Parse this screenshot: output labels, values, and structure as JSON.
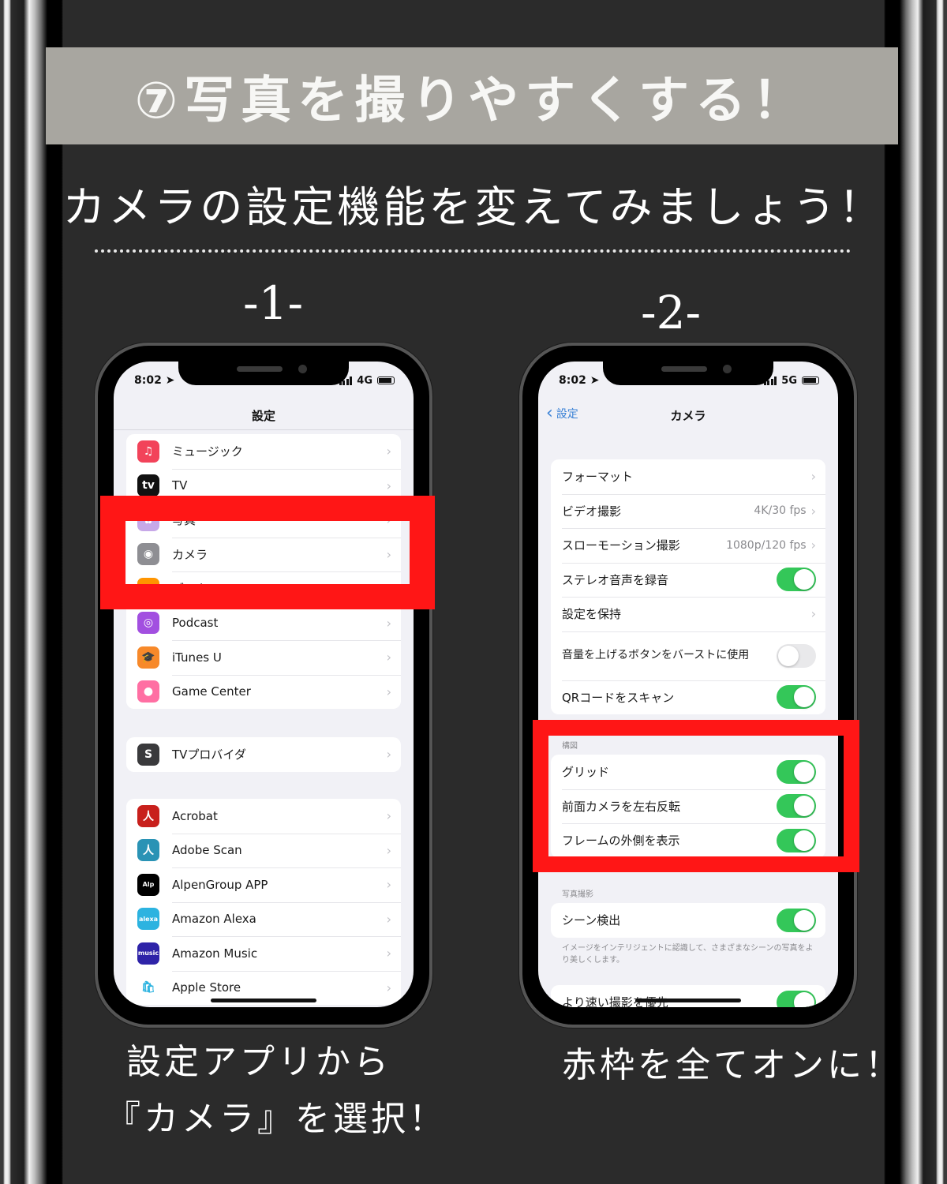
{
  "title": "⑦写真を撮りやすくする！",
  "subtitle": "カメラの設定機能を変えてみましょう！",
  "steps": [
    {
      "number": "-1-",
      "caption_line1": "設定アプリから",
      "caption_line2": "『カメラ』を選択！"
    },
    {
      "number": "-2-",
      "caption_line1": "赤枠を全てオンに！"
    }
  ],
  "phone1": {
    "status": {
      "time": "8:02",
      "network": "4G"
    },
    "nav_title": "設定",
    "group1": [
      {
        "label": "ミュージック",
        "icon": "music-icon",
        "color": "#f2435a",
        "glyph": "♫"
      },
      {
        "label": "TV",
        "icon": "apple-tv-icon",
        "color": "#111111",
        "glyph": "tv"
      },
      {
        "label": "写真",
        "icon": "photos-icon",
        "color": "#c7a8e8",
        "glyph": "✿"
      },
      {
        "label": "カメラ",
        "icon": "camera-icon",
        "color": "#8e8e93",
        "glyph": "◉"
      },
      {
        "label": "ブック",
        "icon": "books-icon",
        "color": "#ff9500",
        "glyph": "▤"
      },
      {
        "label": "Podcast",
        "icon": "podcast-icon",
        "color": "#a24fe0",
        "glyph": "◎"
      },
      {
        "label": "iTunes U",
        "icon": "itunes-u-icon",
        "color": "#f7892a",
        "glyph": "🎓"
      },
      {
        "label": "Game Center",
        "icon": "game-center-icon",
        "color": "#ff6fa3",
        "glyph": "●"
      }
    ],
    "group2": [
      {
        "label": "TVプロバイダ",
        "icon": "tv-provider-icon",
        "color": "#3a3a3c",
        "glyph": "S"
      }
    ],
    "group3": [
      {
        "label": "Acrobat",
        "icon": "acrobat-icon",
        "color": "#c8201c",
        "glyph": "人"
      },
      {
        "label": "Adobe Scan",
        "icon": "adobe-scan-icon",
        "color": "#2a93b5",
        "glyph": "人"
      },
      {
        "label": "AlpenGroup APP",
        "icon": "alpen-group-icon",
        "color": "#000000",
        "glyph": "Alp"
      },
      {
        "label": "Amazon Alexa",
        "icon": "amazon-alexa-icon",
        "color": "#2cb3e0",
        "glyph": "alexa"
      },
      {
        "label": "Amazon Music",
        "icon": "amazon-music-icon",
        "color": "#2e23a8",
        "glyph": "music"
      },
      {
        "label": "Apple Store",
        "icon": "apple-store-icon",
        "color": "#ffffff",
        "glyph": "🛍"
      }
    ]
  },
  "phone2": {
    "status": {
      "time": "8:02",
      "network": "5G"
    },
    "back_label": "設定",
    "nav_title": "カメラ",
    "group1": [
      {
        "label": "フォーマット",
        "value": "",
        "type": "chevron"
      },
      {
        "label": "ビデオ撮影",
        "value": "4K/30 fps",
        "type": "chevron"
      },
      {
        "label": "スローモーション撮影",
        "value": "1080p/120 fps",
        "type": "chevron"
      },
      {
        "label": "ステレオ音声を録音",
        "type": "toggle",
        "on": true
      },
      {
        "label": "設定を保持",
        "value": "",
        "type": "chevron"
      },
      {
        "label": "音量を上げるボタンをバーストに使用",
        "type": "toggle",
        "on": false
      },
      {
        "label": "QRコードをスキャン",
        "type": "toggle",
        "on": true
      }
    ],
    "composition_header": "構図",
    "composition": [
      {
        "label": "グリッド",
        "on": true
      },
      {
        "label": "前面カメラを左右反転",
        "on": true
      },
      {
        "label": "フレームの外側を表示",
        "on": true
      }
    ],
    "photo_header": "写真撮影",
    "photo": [
      {
        "label": "シーン検出",
        "on": true
      }
    ],
    "photo_footer": "イメージをインテリジェントに認識して、さまざまなシーンの写真をより美しくします。",
    "last": [
      {
        "label": "より速い撮影を優先",
        "on": true
      }
    ]
  },
  "colors": {
    "highlight": "#ff1616",
    "toggle_on": "#34c759",
    "banner": "#a8a6a0",
    "background": "#2b2b2b",
    "link": "#3b82d6"
  }
}
